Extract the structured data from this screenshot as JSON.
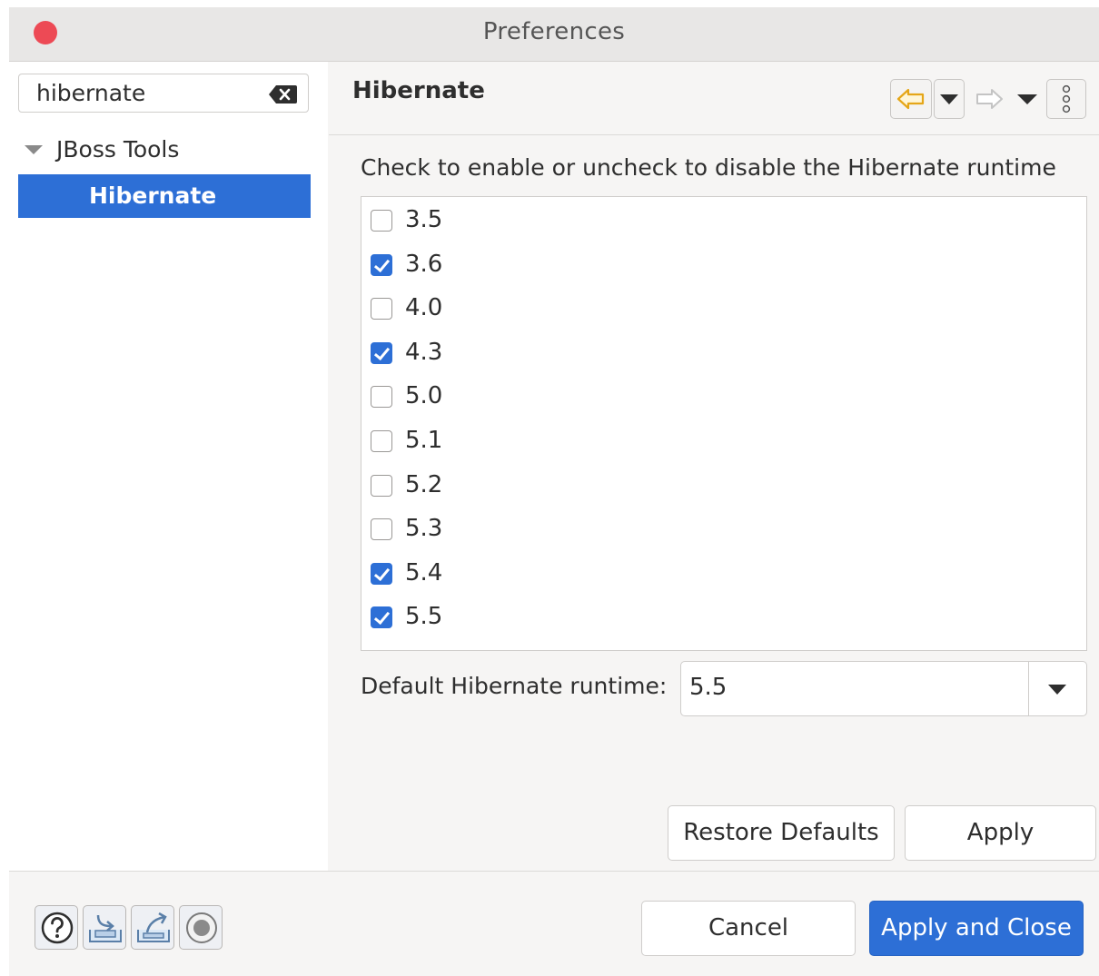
{
  "window": {
    "title": "Preferences"
  },
  "search": {
    "value": "hibernate"
  },
  "tree": {
    "parent": "JBoss Tools",
    "child": "Hibernate"
  },
  "page": {
    "title": "Hibernate",
    "description": "Check to enable or uncheck to disable the Hibernate runtime"
  },
  "runtimes": [
    {
      "label": "3.5",
      "checked": false
    },
    {
      "label": "3.6",
      "checked": true
    },
    {
      "label": "4.0",
      "checked": false
    },
    {
      "label": "4.3",
      "checked": true
    },
    {
      "label": "5.0",
      "checked": false
    },
    {
      "label": "5.1",
      "checked": false
    },
    {
      "label": "5.2",
      "checked": false
    },
    {
      "label": "5.3",
      "checked": false
    },
    {
      "label": "5.4",
      "checked": true
    },
    {
      "label": "5.5",
      "checked": true
    }
  ],
  "default_runtime": {
    "label": "Default Hibernate runtime:",
    "value": "5.5"
  },
  "buttons": {
    "restore_defaults": "Restore Defaults",
    "apply": "Apply",
    "cancel": "Cancel",
    "apply_and_close": "Apply and Close"
  },
  "colors": {
    "accent": "#2d6fd6",
    "close": "#ed4a55",
    "back_arrow": "#e5a618"
  },
  "icons": [
    "back-arrow-icon",
    "forward-arrow-icon",
    "menu-dots-icon",
    "help-icon",
    "import-icon",
    "export-icon",
    "record-icon",
    "clear-search-icon"
  ]
}
